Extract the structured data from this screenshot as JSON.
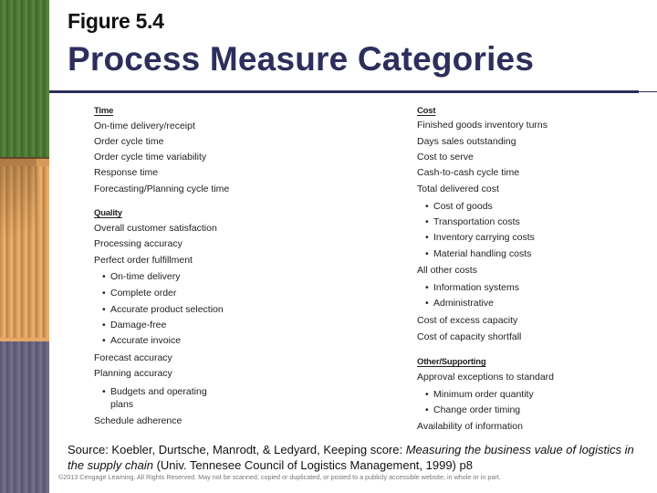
{
  "header": {
    "figure_label": "Figure 5.4",
    "title": "Process Measure Categories"
  },
  "colors": {
    "title": "#2e2e5c",
    "rule": "#2e2e5c",
    "photo_green": "#4f7d37",
    "photo_orange": "#e0a462",
    "photo_purple": "#6a6682"
  },
  "left_column": {
    "sections": [
      {
        "heading": "Time",
        "items": [
          {
            "label": "On-time delivery/receipt",
            "bullet": false
          },
          {
            "label": "Order cycle time",
            "bullet": false
          },
          {
            "label": "Order cycle time variability",
            "bullet": false
          },
          {
            "label": "Response time",
            "bullet": false
          },
          {
            "label": "Forecasting/Planning cycle time",
            "bullet": false
          }
        ]
      },
      {
        "heading": "Quality",
        "items": [
          {
            "label": "Overall customer satisfaction",
            "bullet": false
          },
          {
            "label": "Processing accuracy",
            "bullet": false
          },
          {
            "label": "Perfect order fulfillment",
            "bullet": false
          },
          {
            "label": "On-time delivery",
            "bullet": true
          },
          {
            "label": "Complete order",
            "bullet": true
          },
          {
            "label": "Accurate product selection",
            "bullet": true
          },
          {
            "label": "Damage-free",
            "bullet": true
          },
          {
            "label": "Accurate invoice",
            "bullet": true
          },
          {
            "label": "Forecast accuracy",
            "bullet": false
          },
          {
            "label": "Planning accuracy",
            "bullet": false
          },
          {
            "label": "Budgets and operating plans",
            "bullet": true
          },
          {
            "label": "Schedule adherence",
            "bullet": false
          }
        ]
      }
    ]
  },
  "right_column": {
    "sections": [
      {
        "heading": "Cost",
        "items": [
          {
            "label": "Finished goods inventory turns",
            "bullet": false
          },
          {
            "label": "Days sales outstanding",
            "bullet": false
          },
          {
            "label": "Cost to serve",
            "bullet": false
          },
          {
            "label": "Cash-to-cash cycle time",
            "bullet": false
          },
          {
            "label": "Total delivered cost",
            "bullet": false
          },
          {
            "label": "Cost of goods",
            "bullet": true
          },
          {
            "label": "Transportation costs",
            "bullet": true
          },
          {
            "label": "Inventory carrying costs",
            "bullet": true
          },
          {
            "label": "Material handling costs",
            "bullet": true
          },
          {
            "label": "All other costs",
            "bullet": false
          },
          {
            "label": "Information systems",
            "bullet": true
          },
          {
            "label": "Administrative",
            "bullet": true
          },
          {
            "label": "Cost of excess capacity",
            "bullet": false
          },
          {
            "label": "Cost of capacity shortfall",
            "bullet": false
          }
        ]
      },
      {
        "heading": "Other/Supporting",
        "items": [
          {
            "label": "Approval exceptions to standard",
            "bullet": false
          },
          {
            "label": "Minimum order quantity",
            "bullet": true
          },
          {
            "label": "Change order timing",
            "bullet": true
          },
          {
            "label": "Availability of information",
            "bullet": false
          }
        ]
      }
    ]
  },
  "source": {
    "prefix": "Source: Koebler, Durtsche, Manrodt, & Ledyard, Keeping score: ",
    "italic_title": "Measuring the business value of logistics in the supply chain",
    "suffix": " (Univ. Tennesee Council of Logistics Management, 1999) p8"
  },
  "copyright": "©2013 Cengage Learning. All Rights Reserved. May not be scanned, copied or duplicated, or posted to a publicly accessible website, in whole or in part."
}
